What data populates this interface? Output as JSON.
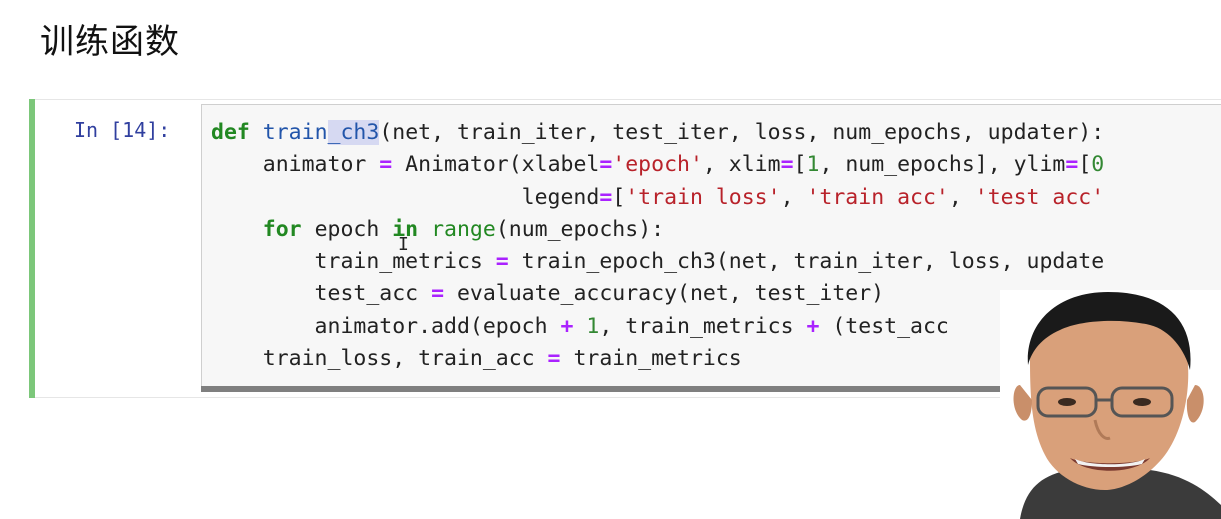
{
  "heading": "训练函数",
  "cell": {
    "prompt": "In [14]:",
    "lines": [
      [
        {
          "t": "def",
          "c": "kw"
        },
        {
          "t": " "
        },
        {
          "t": "train",
          "c": "fn"
        },
        {
          "t": "_ch3",
          "c": "fn hl"
        },
        {
          "t": "(net, train_iter, test_iter, loss, num_epochs, updater):"
        }
      ],
      [
        {
          "t": "    animator "
        },
        {
          "t": "=",
          "c": "op"
        },
        {
          "t": " Animator(xlabel"
        },
        {
          "t": "=",
          "c": "op"
        },
        {
          "t": "'epoch'",
          "c": "str"
        },
        {
          "t": ", xlim"
        },
        {
          "t": "=",
          "c": "op"
        },
        {
          "t": "["
        },
        {
          "t": "1",
          "c": "num"
        },
        {
          "t": ", num_epochs], ylim"
        },
        {
          "t": "=",
          "c": "op"
        },
        {
          "t": "["
        },
        {
          "t": "0",
          "c": "num"
        }
      ],
      [
        {
          "t": "                        legend"
        },
        {
          "t": "=",
          "c": "op"
        },
        {
          "t": "["
        },
        {
          "t": "'train loss'",
          "c": "str"
        },
        {
          "t": ", "
        },
        {
          "t": "'train acc'",
          "c": "str"
        },
        {
          "t": ", "
        },
        {
          "t": "'test acc'",
          "c": "str"
        }
      ],
      [
        {
          "t": "    "
        },
        {
          "t": "for",
          "c": "kw"
        },
        {
          "t": " epoch "
        },
        {
          "t": "in",
          "c": "kw"
        },
        {
          "t": " "
        },
        {
          "t": "range",
          "c": "bi"
        },
        {
          "t": "(num_epochs):"
        }
      ],
      [
        {
          "t": "        train_metrics "
        },
        {
          "t": "=",
          "c": "op"
        },
        {
          "t": " train_epoch_ch3(net, train_iter, loss, update"
        }
      ],
      [
        {
          "t": "        test_acc "
        },
        {
          "t": "=",
          "c": "op"
        },
        {
          "t": " evaluate_accuracy(net, test_iter)"
        }
      ],
      [
        {
          "t": "        animator.add(epoch "
        },
        {
          "t": "+",
          "c": "op"
        },
        {
          "t": " "
        },
        {
          "t": "1",
          "c": "num"
        },
        {
          "t": ", train_metrics "
        },
        {
          "t": "+",
          "c": "op"
        },
        {
          "t": " (test_acc"
        }
      ],
      [
        {
          "t": "    train_loss, train_acc "
        },
        {
          "t": "=",
          "c": "op"
        },
        {
          "t": " train_metrics"
        }
      ]
    ]
  },
  "colors": {
    "cell_bar": "#7cc77a",
    "prompt": "#303f9f",
    "keyword": "#228822",
    "operator": "#aa22ff",
    "string": "#b8222a",
    "function_name": "#2255aa"
  }
}
